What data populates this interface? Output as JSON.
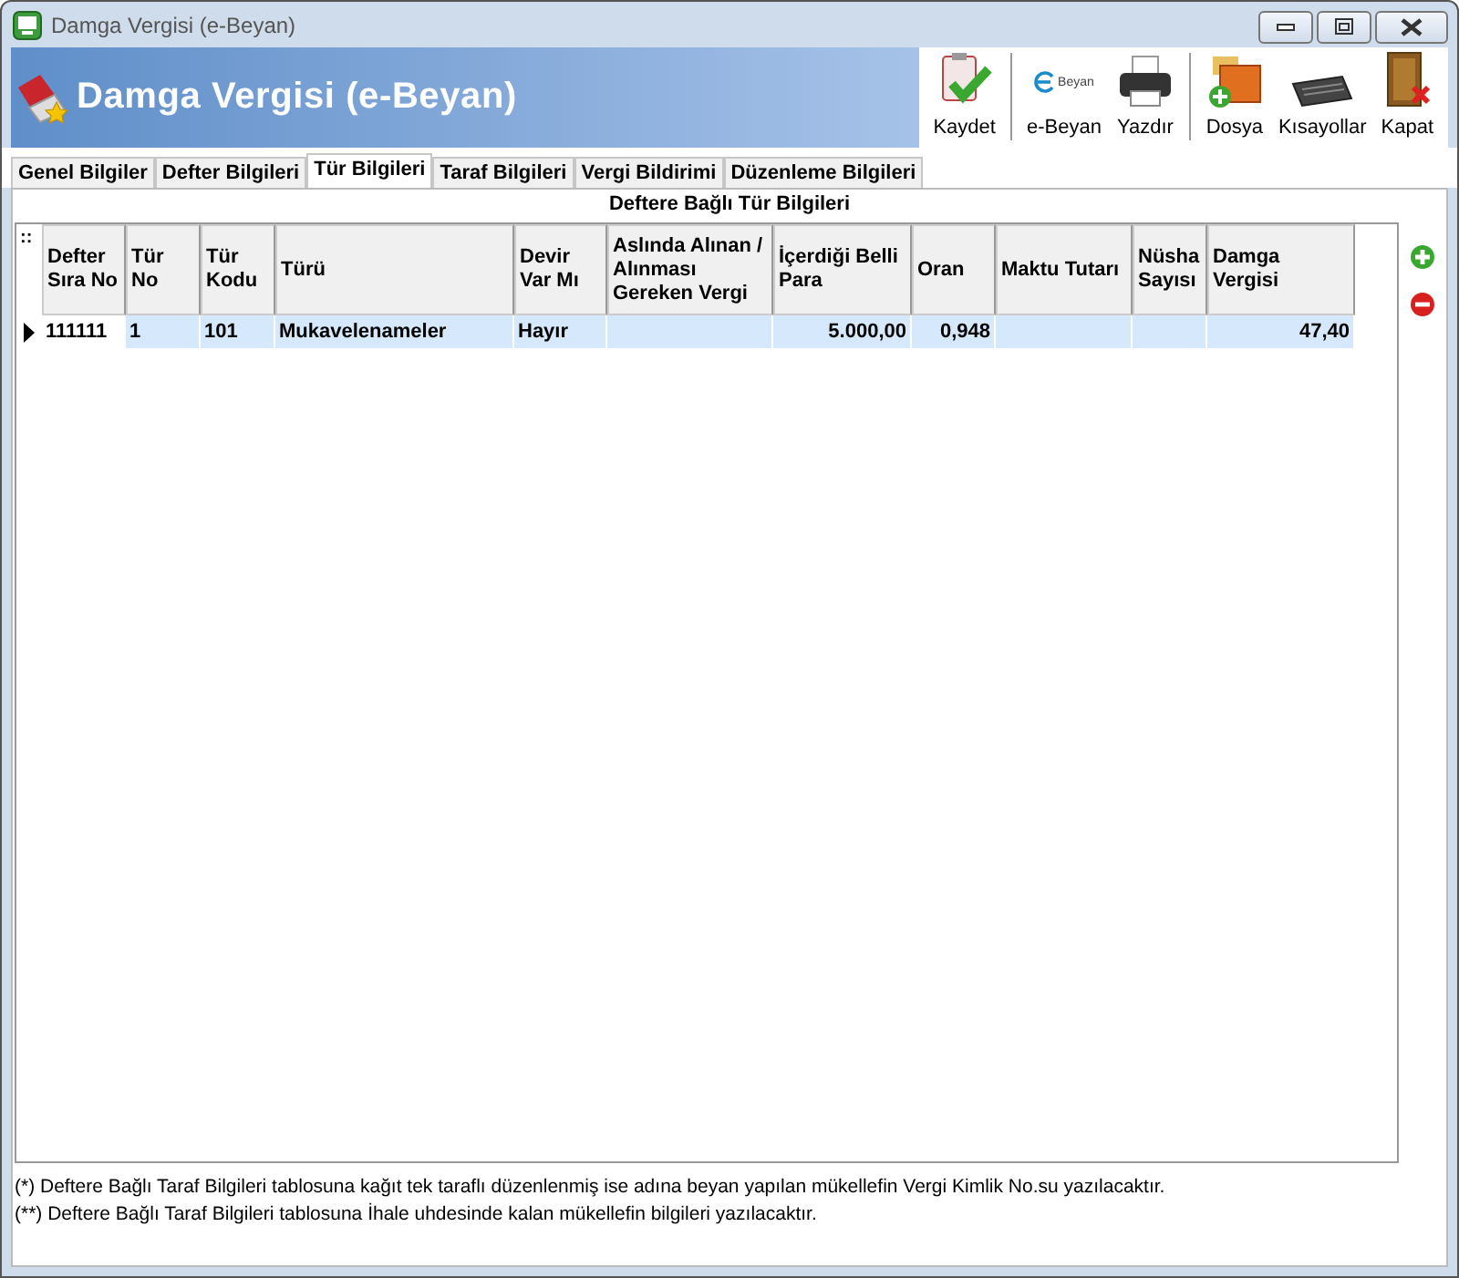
{
  "window": {
    "title": "Damga Vergisi (e-Beyan)"
  },
  "header": {
    "title": "Damga Vergisi (e-Beyan)"
  },
  "toolbar": [
    {
      "label": "Kaydet",
      "kind": "save"
    },
    {
      "label": "e-Beyan",
      "kind": "ebeyan",
      "logo_text": "Beyan"
    },
    {
      "label": "Yazdır",
      "kind": "print"
    },
    {
      "label": "Dosya",
      "kind": "file"
    },
    {
      "label": "Kısayollar",
      "kind": "keyboard"
    },
    {
      "label": "Kapat",
      "kind": "close"
    }
  ],
  "tabs": [
    {
      "label": "Genel Bilgiler",
      "selected": false
    },
    {
      "label": "Defter Bilgileri",
      "selected": false
    },
    {
      "label": "Tür Bilgileri",
      "selected": true
    },
    {
      "label": "Taraf Bilgileri",
      "selected": false
    },
    {
      "label": "Vergi Bildirimi",
      "selected": false
    },
    {
      "label": "Düzenleme Bilgileri",
      "selected": false
    }
  ],
  "section_title": "Deftere Bağlı Tür Bilgileri",
  "table": {
    "corner": "::",
    "columns": [
      {
        "label": "Defter Sıra No"
      },
      {
        "label": "Tür No"
      },
      {
        "label": "Tür Kodu"
      },
      {
        "label": "Türü"
      },
      {
        "label": "Devir Var Mı"
      },
      {
        "label": "Aslında Alınan / Alınması Gereken Vergi"
      },
      {
        "label": "İçerdiği Belli Para"
      },
      {
        "label": "Oran"
      },
      {
        "label": "Maktu Tutarı"
      },
      {
        "label": "Nüsha Sayısı"
      },
      {
        "label": "Damga Vergisi"
      }
    ],
    "rows": [
      {
        "selected": true,
        "cells": [
          "111111",
          "1",
          "101",
          "Mukavelenameler",
          "Hayır",
          "",
          "5.000,00",
          "0,948",
          "",
          "",
          "47,40"
        ]
      }
    ]
  },
  "notes": [
    "(*) Deftere Bağlı Taraf Bilgileri tablosuna kağıt tek taraflı düzenlenmiş ise adına beyan yapılan mükellefin Vergi Kimlik No.su yazılacaktır.",
    "(**) Deftere Bağlı Taraf Bilgileri tablosuna İhale uhdesinde kalan mükellefin bilgileri yazılacaktır."
  ]
}
